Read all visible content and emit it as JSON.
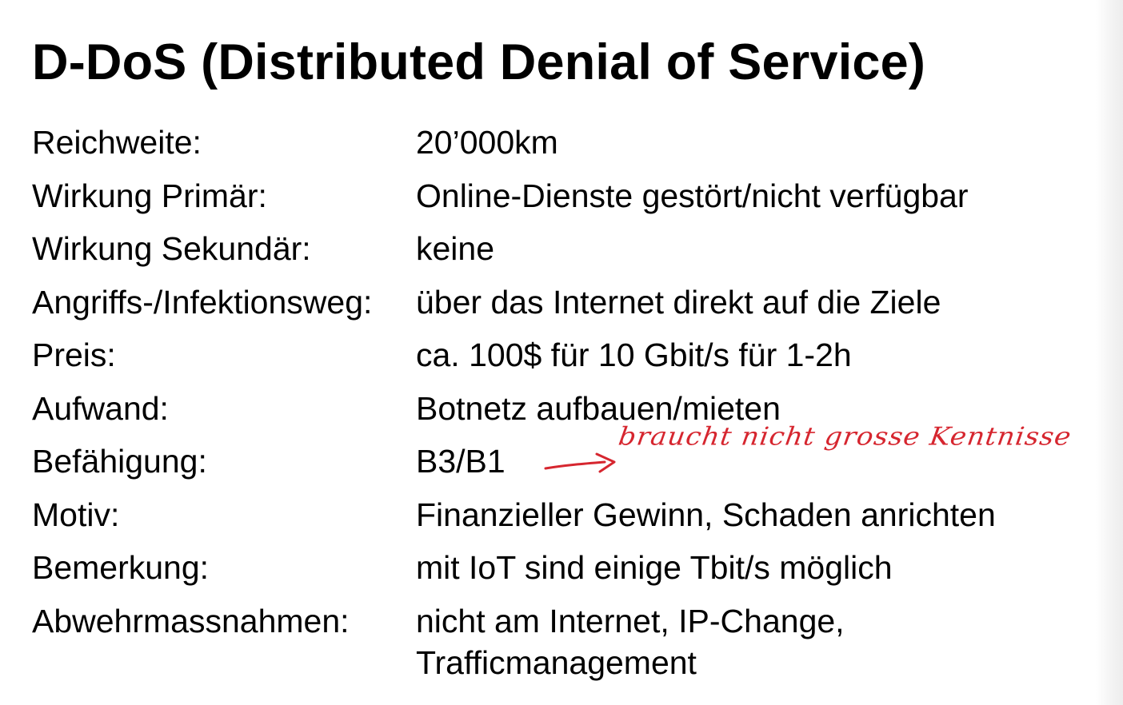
{
  "slide": {
    "title": "D-DoS (Distributed Denial of Service)",
    "rows": [
      {
        "label": "Reichweite:",
        "value": "20’000km"
      },
      {
        "label": "Wirkung Primär:",
        "value": "Online-Dienste gestört/nicht verfügbar"
      },
      {
        "label": "Wirkung Sekundär:",
        "value": "keine"
      },
      {
        "label": "Angriffs-/Infektionsweg:",
        "value": "über das Internet direkt auf die Ziele"
      },
      {
        "label": "Preis:",
        "value": "ca. 100$ für 10 Gbit/s für 1-2h"
      },
      {
        "label": "Aufwand:",
        "value": "Botnetz aufbauen/mieten"
      },
      {
        "label": "Befähigung:",
        "value": "B3/B1"
      },
      {
        "label": "Motiv:",
        "value": "Finanzieller Gewinn, Schaden anrichten"
      },
      {
        "label": "Bemerkung:",
        "value": "mit IoT sind einige Tbit/s möglich"
      },
      {
        "label": "Abwehrmassnahmen:",
        "value": "nicht am Internet, IP-Change, Trafficmanagement"
      }
    ],
    "handwritten_note": {
      "text": "braucht nicht grosse Kentnisse",
      "color": "#d6262f",
      "arrow_icon": "arrow-right-icon"
    }
  }
}
